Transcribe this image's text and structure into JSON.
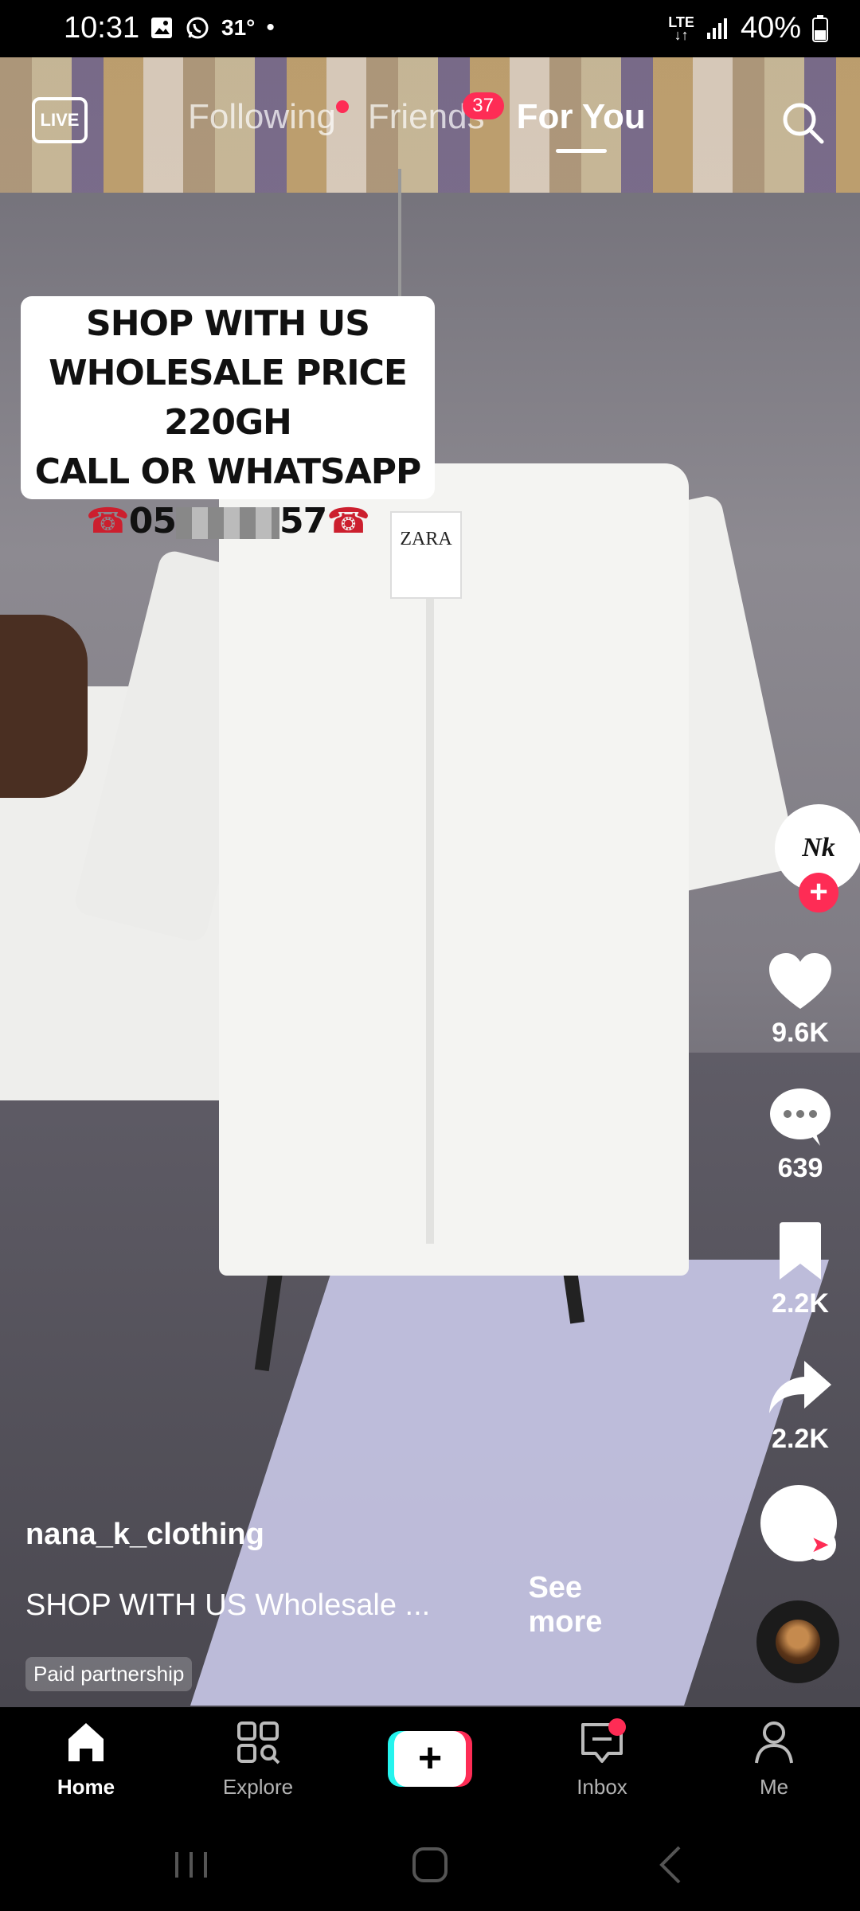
{
  "status_bar": {
    "time": "10:31",
    "temperature": "31°",
    "dot": "•",
    "network": "LTE",
    "battery": "40%"
  },
  "top_nav": {
    "live_label": "LIVE",
    "tabs": [
      {
        "label": "Following",
        "has_dot": true
      },
      {
        "label": "Friends",
        "badge": "37"
      },
      {
        "label": "For You",
        "active": true
      }
    ]
  },
  "video_overlay": {
    "line1": "SHOP WITH US",
    "line2": "WHOLESALE PRICE 220GH",
    "line3": "CALL OR WHATSAPP",
    "phone_prefix": "05",
    "phone_suffix": "57",
    "phone_icon": "☎",
    "tag_brand": "ZARA"
  },
  "right_rail": {
    "avatar_logo": "Nk",
    "likes": "9.6K",
    "comments": "639",
    "bookmarks": "2.2K",
    "shares": "2.2K"
  },
  "caption": {
    "username": "nana_k_clothing",
    "text": "SHOP WITH US Wholesale ...",
    "see_more": "See more",
    "paid_tag": "Paid partnership"
  },
  "bottom_nav": {
    "items": [
      {
        "label": "Home",
        "icon": "home-icon",
        "active": true
      },
      {
        "label": "Explore",
        "icon": "explore-icon"
      },
      {
        "label": "",
        "icon": "create-icon"
      },
      {
        "label": "Inbox",
        "icon": "inbox-icon",
        "has_dot": true
      },
      {
        "label": "Me",
        "icon": "profile-icon"
      }
    ],
    "create_symbol": "+"
  },
  "colors": {
    "accent_red": "#fe2c55",
    "accent_cyan": "#25f4ee"
  }
}
